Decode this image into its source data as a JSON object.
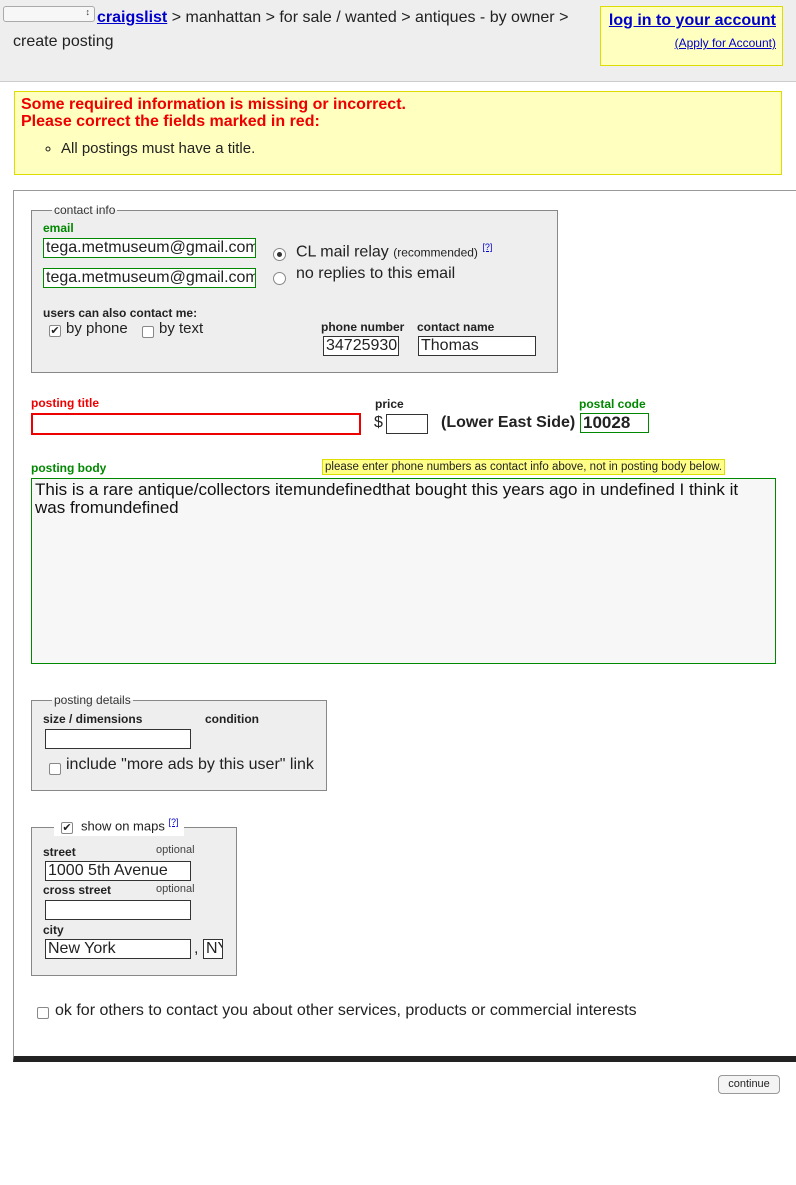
{
  "header": {
    "breadcrumb": {
      "home": "craigslist",
      "path": "> manhattan > for sale / wanted > antiques - by owner > create posting"
    },
    "login_link": "log in to your account",
    "apply_link": "(Apply for Account)"
  },
  "errors": {
    "line1": "Some required information is missing or incorrect.",
    "line2": "Please correct the fields marked in red:",
    "items": [
      "All postings must have a title."
    ]
  },
  "contact": {
    "legend": "contact info",
    "email_label": "email",
    "email_value": "tega.metmuseum@gmail.com",
    "email_confirm": "tega.metmuseum@gmail.com",
    "relay_label": "CL mail relay",
    "relay_note": "(recommended)",
    "help": "[?]",
    "noreply_label": "no replies to this email",
    "also_contact": "users can also contact me:",
    "by_phone": "by phone",
    "by_text": "by text",
    "phone_label": "phone number",
    "phone_value": "34725930",
    "name_label": "contact name",
    "name_value": "Thomas"
  },
  "posting": {
    "title_label": "posting title",
    "title_value": "",
    "price_label": "price",
    "currency": "$",
    "price_value": "",
    "area": "(Lower East Side)",
    "postal_label": "postal code",
    "postal_value": "10028",
    "body_label": "posting body",
    "body_hint": "please enter phone numbers as contact info above, not in posting body below.",
    "body_value": "This is a rare antique/collectors itemundefinedthat bought this years ago in undefined I think it was fromundefined"
  },
  "details": {
    "legend": "posting details",
    "size_label": "size / dimensions",
    "condition_label": "condition",
    "size_value": "",
    "more_ads_label": "include \"more ads by this user\" link"
  },
  "maps": {
    "legend": "show on maps",
    "help": "[?]",
    "street_label": "street",
    "street_value": "1000 5th Avenue",
    "optional": "optional",
    "cross_label": "cross street",
    "cross_value": "",
    "city_label": "city",
    "city_value": "New York",
    "comma": ",",
    "state_value": "NY"
  },
  "consent_label": "ok for others to contact you about other services, products or commercial interests",
  "continue_label": "continue"
}
